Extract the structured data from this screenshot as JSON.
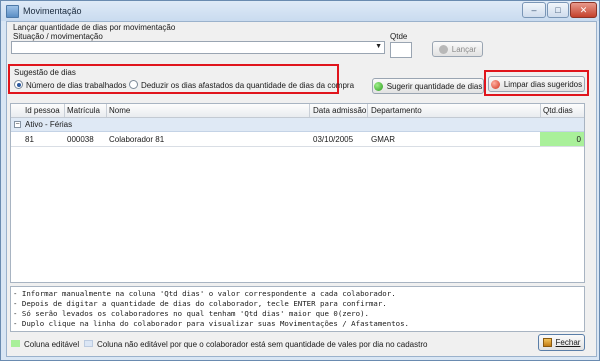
{
  "window": {
    "title": "Movimentação",
    "min_glyph": "–",
    "max_glyph": "□",
    "close_glyph": "✕"
  },
  "form": {
    "section_label": "Lançar quantidade de dias por movimentação",
    "situacao_label": "Situação / movimentação",
    "situacao_value": "",
    "qtde_label": "Qtde",
    "qtde_value": "",
    "lancar_label": "Lançar"
  },
  "sugestao": {
    "legend": "Sugestão de dias",
    "options": [
      {
        "label": "Número de dias trabalhados",
        "selected": true
      },
      {
        "label": "Deduzir os dias afastados da quantidade de dias da compra",
        "selected": false
      }
    ],
    "sugerir_label": "Sugerir quantidade de dias",
    "limpar_label": "Limpar dias sugeridos"
  },
  "grid": {
    "columns": [
      "Id pessoa",
      "Matrícula",
      "Nome",
      "Data admissão",
      "Departamento",
      "Qtd.dias"
    ],
    "group": "Ativo - Férias",
    "rows": [
      {
        "id": "81",
        "matricula": "000038",
        "nome": "Colaborador 81",
        "data": "03/10/2005",
        "departamento": "GMAR",
        "qtd": "0"
      }
    ]
  },
  "info_lines": [
    "- Informar manualmente na coluna 'Qtd dias' o valor correspondente a cada colaborador.",
    "- Depois de digitar a quantidade de dias do colaborador, tecle ENTER para confirmar.",
    "- Só serão levados os colaboradores no qual tenham 'Qtd dias' maior que 0(zero).",
    "- Duplo clique na linha do colaborador para visualizar suas Movimentações / Afastamentos."
  ],
  "legend": {
    "editable_label": "Coluna editável",
    "editable_color": "#a9f09a",
    "noneditable_label": "Coluna não editável por que o colaborador está sem quantidade de vales por dia no cadastro",
    "noneditable_color": "#dbe6f5"
  },
  "footer": {
    "fechar_label": "Fechar"
  },
  "colors": {
    "highlight": "#e0151c",
    "editable_cell": "#a9f09a"
  }
}
